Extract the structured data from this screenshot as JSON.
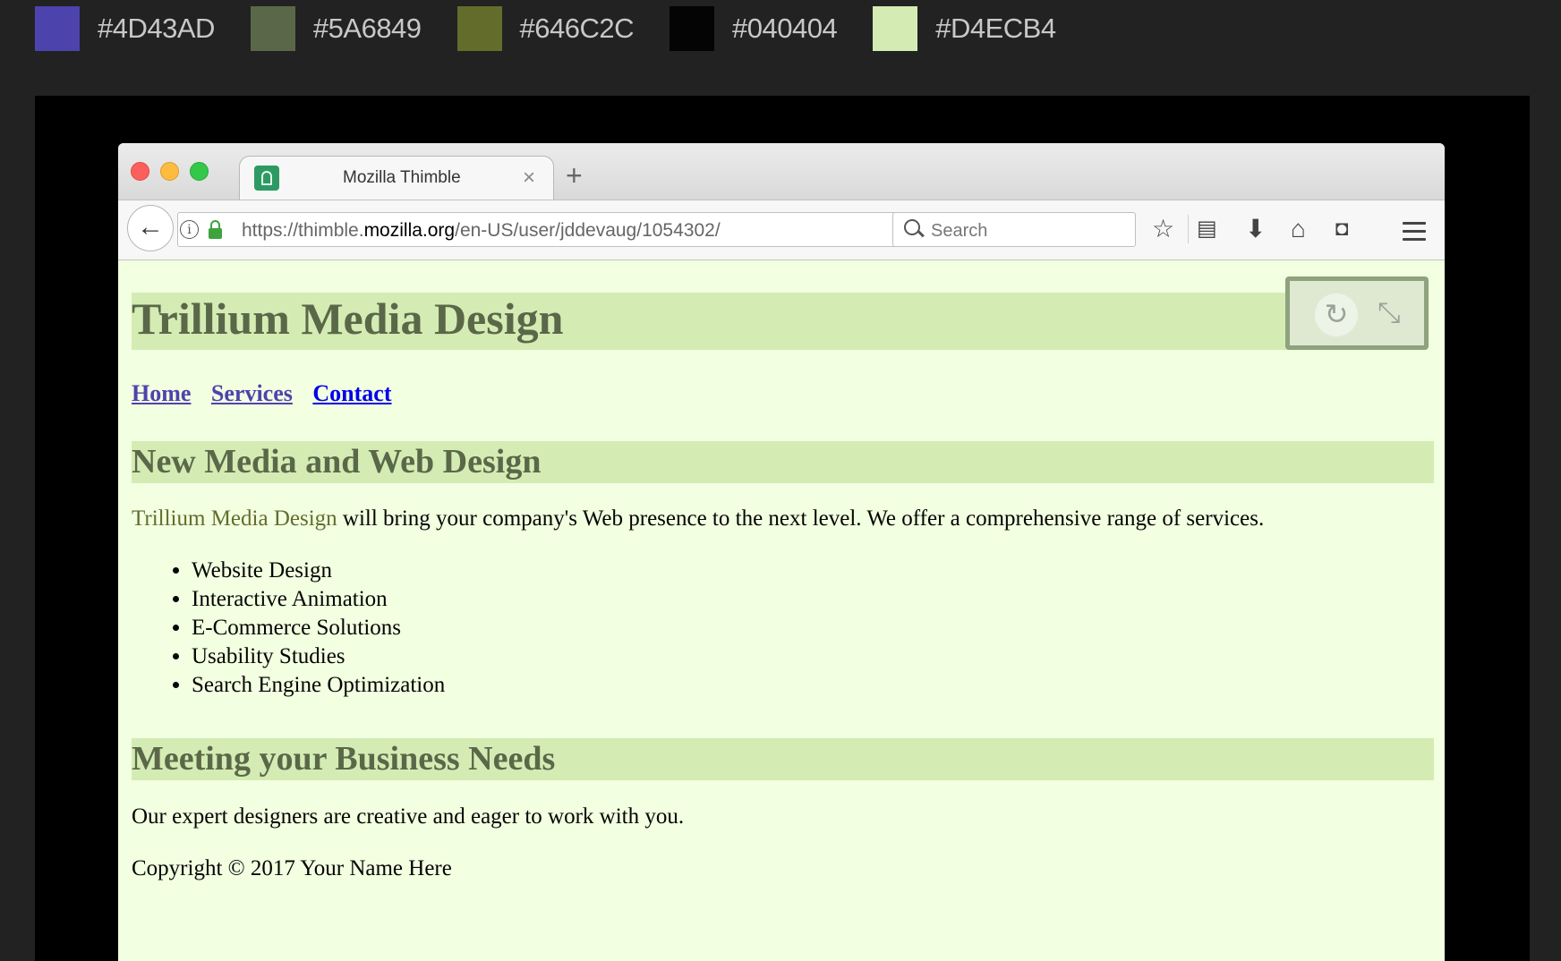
{
  "palette": [
    {
      "hex": "#4D43AD"
    },
    {
      "hex": "#5A6849"
    },
    {
      "hex": "#646C2C"
    },
    {
      "hex": "#040404"
    },
    {
      "hex": "#D4ECB4"
    }
  ],
  "browser": {
    "tab_title": "Mozilla Thimble",
    "url": {
      "prefix": "https://thimble.",
      "domain": "mozilla.org",
      "path": "/en-US/user/jddevaug/1054302/"
    },
    "search_placeholder": "Search"
  },
  "page": {
    "title": "Trillium Media Design",
    "nav": [
      "Home",
      "Services",
      "Contact"
    ],
    "heading1": "New Media and Web Design",
    "intro_brand": "Trillium Media Design",
    "intro_rest": " will bring your company's Web presence to the next level. We offer a comprehensive range of services.",
    "services": [
      "Website Design",
      "Interactive Animation",
      "E-Commerce Solutions",
      "Usability Studies",
      "Search Engine Optimization"
    ],
    "heading2": "Meeting your Business Needs",
    "expert": "Our expert designers are creative and eager to work with you.",
    "copyright": "Copyright © 2017 Your Name Here"
  },
  "colors": {
    "visited_link": "#4D43AD",
    "heading_text": "#5A6849",
    "brand_text": "#646C2C",
    "body_text": "#040404",
    "heading_bg": "#D4ECB4"
  }
}
